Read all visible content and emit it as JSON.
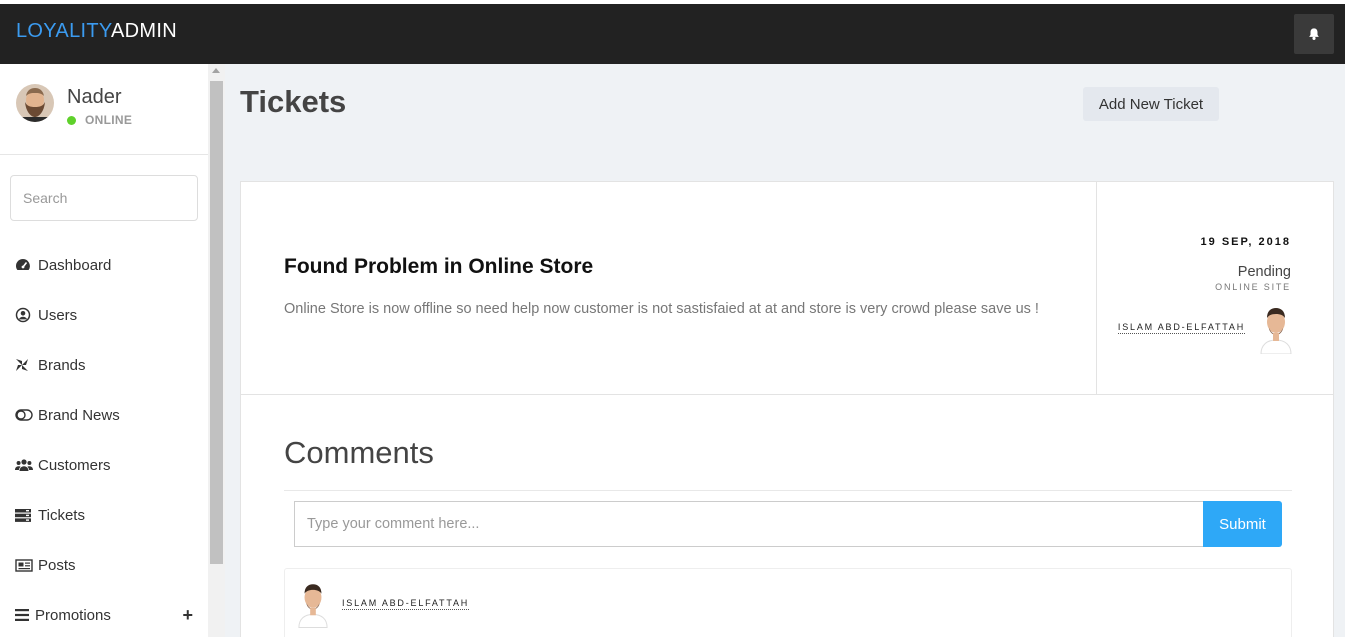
{
  "app": {
    "brand_part1": "LOYALITY",
    "brand_part2": "ADMIN"
  },
  "colors": {
    "accent": "#2ea8f7",
    "brand_blue": "#3b9bf0",
    "topbar": "#222222",
    "online": "#5fd12b",
    "background": "#eff2f5"
  },
  "header": {
    "notification_icon": "bell-icon"
  },
  "user": {
    "name": "Nader",
    "status": "ONLINE"
  },
  "sidebar": {
    "search_placeholder": "Search",
    "items": [
      {
        "label": "Dashboard",
        "icon": "dashboard-icon"
      },
      {
        "label": "Users",
        "icon": "user-circle-icon"
      },
      {
        "label": "Brands",
        "icon": "pinwheel-icon"
      },
      {
        "label": "Brand News",
        "icon": "toggle-icon"
      },
      {
        "label": "Customers",
        "icon": "users-icon"
      },
      {
        "label": "Tickets",
        "icon": "server-icon"
      },
      {
        "label": "Posts",
        "icon": "newspaper-icon"
      },
      {
        "label": "Promotions",
        "icon": "bars-icon",
        "expand": "+"
      }
    ]
  },
  "page": {
    "title": "Tickets",
    "add_button": "Add New Ticket"
  },
  "ticket": {
    "title": "Found Problem in Online Store",
    "description": "Online Store is now offline so need help now customer is not sastisfaied at at and store is very crowd please save us !",
    "date": "19 SEP, 2018",
    "status": "Pending",
    "source": "ONLINE SITE",
    "assignee": "ISLAM ABD-ELFATTAH"
  },
  "comments": {
    "heading": "Comments",
    "input_placeholder": "Type your comment here...",
    "submit_label": "Submit",
    "items": [
      {
        "author": "ISLAM ABD-ELFATTAH"
      }
    ]
  }
}
